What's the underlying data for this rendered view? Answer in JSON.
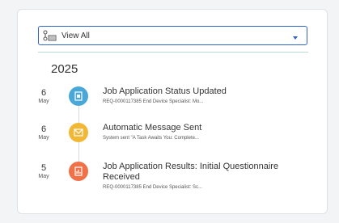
{
  "filter": {
    "selected": "View All",
    "icon": "filter-list-icon",
    "caret_icon": "caret-down-icon"
  },
  "year": "2025",
  "events": [
    {
      "day": "6",
      "month": "May",
      "title": "Job Application Status Updated",
      "subtitle": "REQ-0000117385 End Device Specialist: Mo...",
      "icon": "document-icon",
      "color": "#4aa8d8"
    },
    {
      "day": "6",
      "month": "May",
      "title": "Automatic Message Sent",
      "subtitle": "System sent \"A Task Awaits You: Complete...",
      "icon": "envelope-icon",
      "color": "#f2b835"
    },
    {
      "day": "5",
      "month": "May",
      "title": "Job Application Results: Initial Questionnaire Received",
      "subtitle": "REQ-0000117385 End Device Specialist: Sc...",
      "icon": "report-icon",
      "color": "#f07048"
    }
  ]
}
